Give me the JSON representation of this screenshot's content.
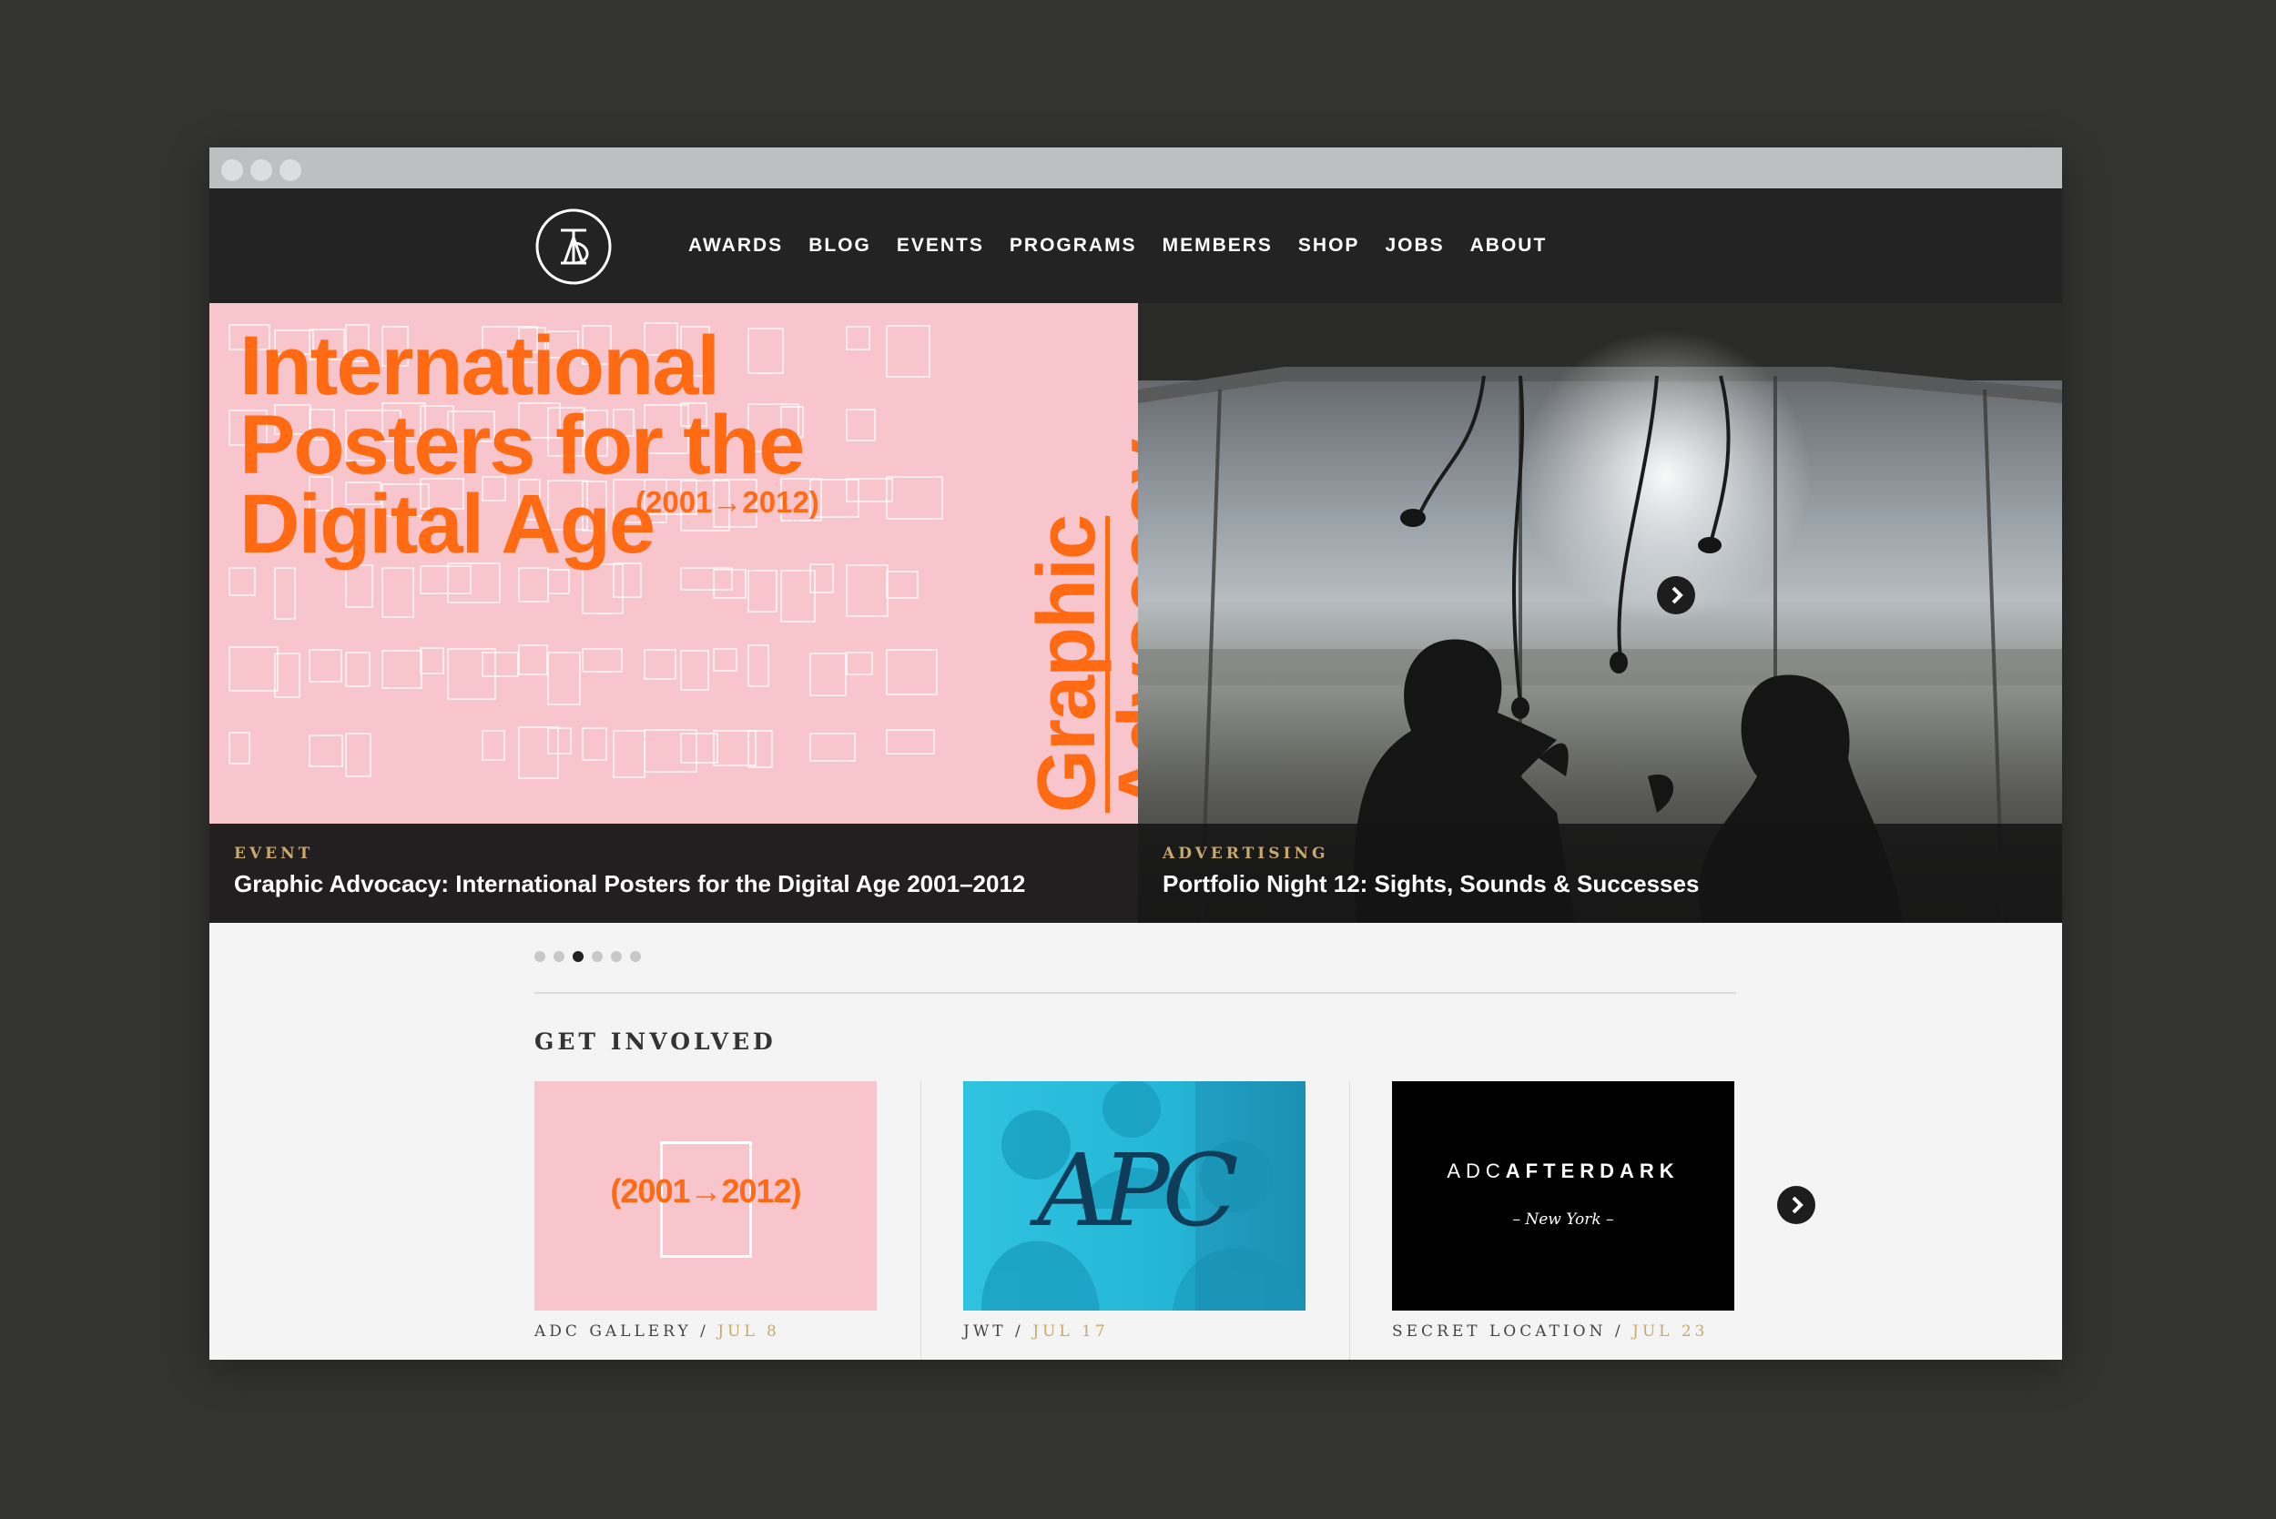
{
  "nav": {
    "items": [
      "AWARDS",
      "BLOG",
      "EVENTS",
      "PROGRAMS",
      "MEMBERS",
      "SHOP",
      "JOBS",
      "ABOUT"
    ]
  },
  "hero": {
    "poster": {
      "title_lines": [
        "International",
        "Posters for the",
        "Digital Age"
      ],
      "years": "(2001→2012)",
      "vertical_lines": [
        "Graphic",
        "Advocacy"
      ]
    },
    "slides": [
      {
        "category": "EVENT",
        "title": "Graphic Advocacy: International Posters for the Digital Age 2001–2012"
      },
      {
        "category": "ADVERTISING",
        "title": "Portfolio Night 12: Sights, Sounds & Successes"
      }
    ],
    "next_icon": "chevron-right-icon",
    "pager_count": 6,
    "pager_active": 3
  },
  "get_involved": {
    "title": "GET INVOLVED",
    "cards": [
      {
        "image_text": "(2001→2012)",
        "location": "ADC GALLERY",
        "date": "JUL 8"
      },
      {
        "image_text": "APC",
        "location": "JWT",
        "date": "JUL 17"
      },
      {
        "image_text_adc": "ADC",
        "image_text_after": "AFTERDARK",
        "image_text_city": "– New York –",
        "location": "SECRET LOCATION",
        "date": "JUL 23"
      }
    ],
    "separator": " / "
  },
  "colors": {
    "accent_orange": "#ff6a13",
    "poster_pink": "#f8c5cd",
    "gold": "#c9a86a",
    "cyan": "#27c6e4",
    "nav_bg": "#232323"
  }
}
